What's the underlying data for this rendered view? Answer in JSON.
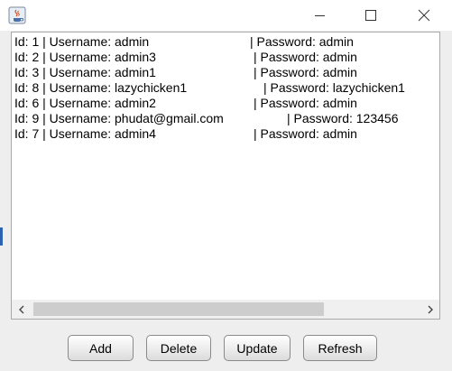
{
  "window": {
    "title": "",
    "icons": [
      "java-app-icon",
      "minimize-icon",
      "maximize-icon",
      "close-icon"
    ]
  },
  "records": [
    {
      "text": "Id: 1 | Username: admin",
      "pw": "| Password: admin"
    },
    {
      "text": "Id: 2 | Username: admin3",
      "pw": "| Password: admin"
    },
    {
      "text": "Id: 3 | Username: admin1",
      "pw": "| Password: admin"
    },
    {
      "text": "Id: 8 | Username: lazychicken1",
      "pw": "| Password: lazychicken1"
    },
    {
      "text": "Id: 6 | Username: admin2",
      "pw": "| Password: admin"
    },
    {
      "text": "Id: 9 | Username: phudat@gmail.com",
      "pw": "| Password: 123456"
    },
    {
      "text": "Id: 7 | Username: admin4",
      "pw": "| Password: admin"
    }
  ],
  "buttons": {
    "add": "Add",
    "delete": "Delete",
    "update": "Update",
    "refresh": "Refresh"
  },
  "scrollbar": {
    "left_icon": "chevron-left-icon",
    "right_icon": "chevron-right-icon"
  }
}
